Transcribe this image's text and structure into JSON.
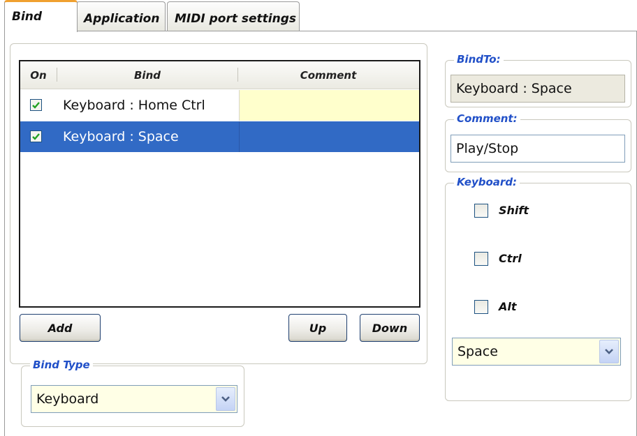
{
  "tabs": [
    {
      "label": "Bind",
      "active": true
    },
    {
      "label": "Application",
      "active": false
    },
    {
      "label": "MIDI port settings",
      "active": false
    }
  ],
  "binds_table": {
    "columns": [
      "On",
      "Bind",
      "Comment"
    ],
    "rows": [
      {
        "on": true,
        "bind": "Keyboard : Home  Ctrl",
        "comment": "",
        "selected": false
      },
      {
        "on": true,
        "bind": "Keyboard : Space",
        "comment": "",
        "selected": true
      }
    ]
  },
  "buttons": {
    "add": "Add",
    "up": "Up",
    "down": "Down"
  },
  "bind_type": {
    "title": "Bind Type",
    "value": "Keyboard"
  },
  "bind_to": {
    "title": "BindTo:",
    "value": "Keyboard : Space"
  },
  "comment": {
    "title": "Comment:",
    "value": "Play/Stop"
  },
  "keyboard": {
    "title": "Keyboard:",
    "modifiers": [
      {
        "label": "Shift",
        "checked": false
      },
      {
        "label": "Ctrl",
        "checked": false
      },
      {
        "label": "Alt",
        "checked": false
      }
    ],
    "key_value": "Space"
  },
  "colors": {
    "accent_tab": "#f0a030",
    "group_title": "#2150c8",
    "selected_row": "#316ac5",
    "comment_cell": "#ffffcc",
    "check_mark": "#21a121"
  }
}
